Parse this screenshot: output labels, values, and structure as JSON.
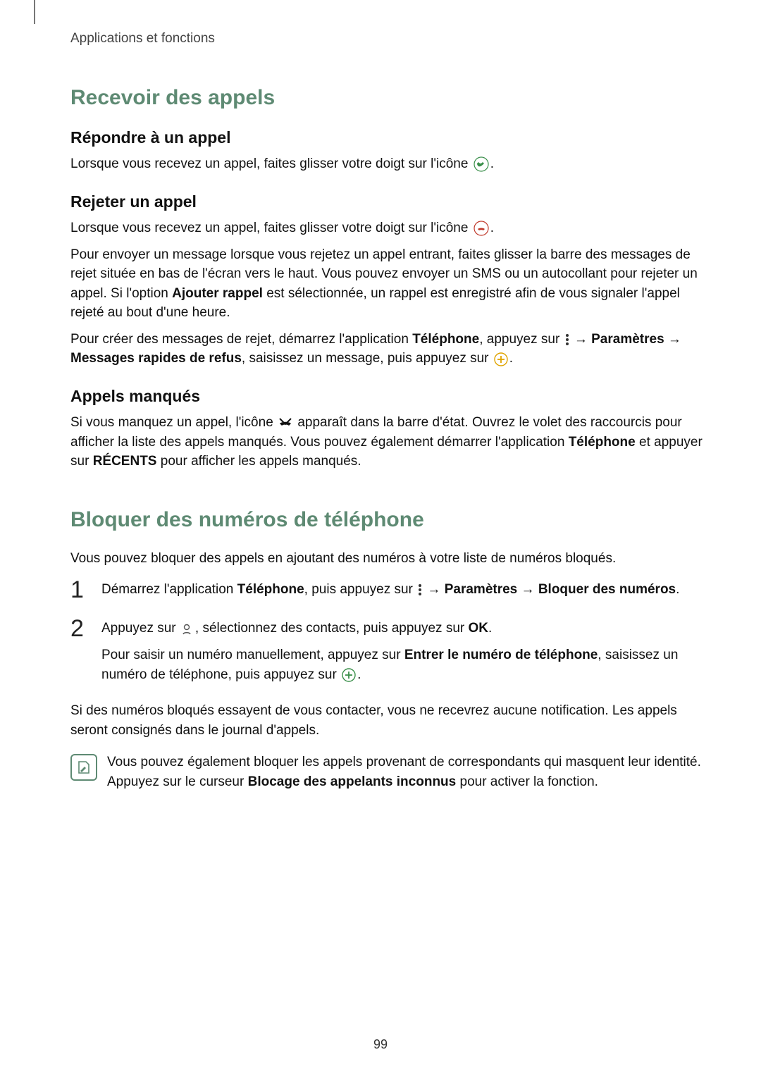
{
  "breadcrumb": "Applications et fonctions",
  "section1": {
    "title": "Recevoir des appels",
    "sub1": {
      "heading": "Répondre à un appel",
      "p1a": "Lorsque vous recevez un appel, faites glisser votre doigt sur l'icône ",
      "p1b": "."
    },
    "sub2": {
      "heading": "Rejeter un appel",
      "p1a": "Lorsque vous recevez un appel, faites glisser votre doigt sur l'icône ",
      "p1b": ".",
      "p2a": "Pour envoyer un message lorsque vous rejetez un appel entrant, faites glisser la barre des messages de rejet située en bas de l'écran vers le haut. Vous pouvez envoyer un SMS ou un autocollant pour rejeter un appel. Si l'option ",
      "p2bold1": "Ajouter rappel",
      "p2b": " est sélectionnée, un rappel est enregistré afin de vous signaler l'appel rejeté au bout d'une heure.",
      "p3a": "Pour créer des messages de rejet, démarrez l'application ",
      "p3bold1": "Téléphone",
      "p3b": ", appuyez sur ",
      "p3arrow1": " → ",
      "p3bold2": "Paramètres",
      "p3arrow2": " → ",
      "p3bold3": "Messages rapides de refus",
      "p3c": ", saisissez un message, puis appuyez sur ",
      "p3d": "."
    },
    "sub3": {
      "heading": "Appels manqués",
      "p1a": "Si vous manquez un appel, l'icône ",
      "p1b": " apparaît dans la barre d'état. Ouvrez le volet des raccourcis pour afficher la liste des appels manqués. Vous pouvez également démarrer l'application ",
      "p1bold1": "Téléphone",
      "p1c": " et appuyer sur ",
      "p1bold2": "RÉCENTS",
      "p1d": " pour afficher les appels manqués."
    }
  },
  "section2": {
    "title": "Bloquer des numéros de téléphone",
    "p1": "Vous pouvez bloquer des appels en ajoutant des numéros à votre liste de numéros bloqués.",
    "step1": {
      "num": "1",
      "a": "Démarrez l'application ",
      "bold1": "Téléphone",
      "b": ", puis appuyez sur ",
      "arrow1": " → ",
      "bold2": "Paramètres",
      "arrow2": " → ",
      "bold3": "Bloquer des numéros",
      "c": "."
    },
    "step2": {
      "num": "2",
      "a": "Appuyez sur ",
      "b": ", sélectionnez des contacts, puis appuyez sur ",
      "bold1": "OK",
      "c": ".",
      "p2a": "Pour saisir un numéro manuellement, appuyez sur ",
      "p2bold1": "Entrer le numéro de téléphone",
      "p2b": ", saisissez un numéro de téléphone, puis appuyez sur ",
      "p2c": "."
    },
    "p_after": "Si des numéros bloqués essayent de vous contacter, vous ne recevrez aucune notification. Les appels seront consignés dans le journal d'appels.",
    "note": {
      "a": "Vous pouvez également bloquer les appels provenant de correspondants qui masquent leur identité. Appuyez sur le curseur ",
      "bold1": "Blocage des appelants inconnus",
      "b": " pour activer la fonction."
    }
  },
  "page_number": "99"
}
